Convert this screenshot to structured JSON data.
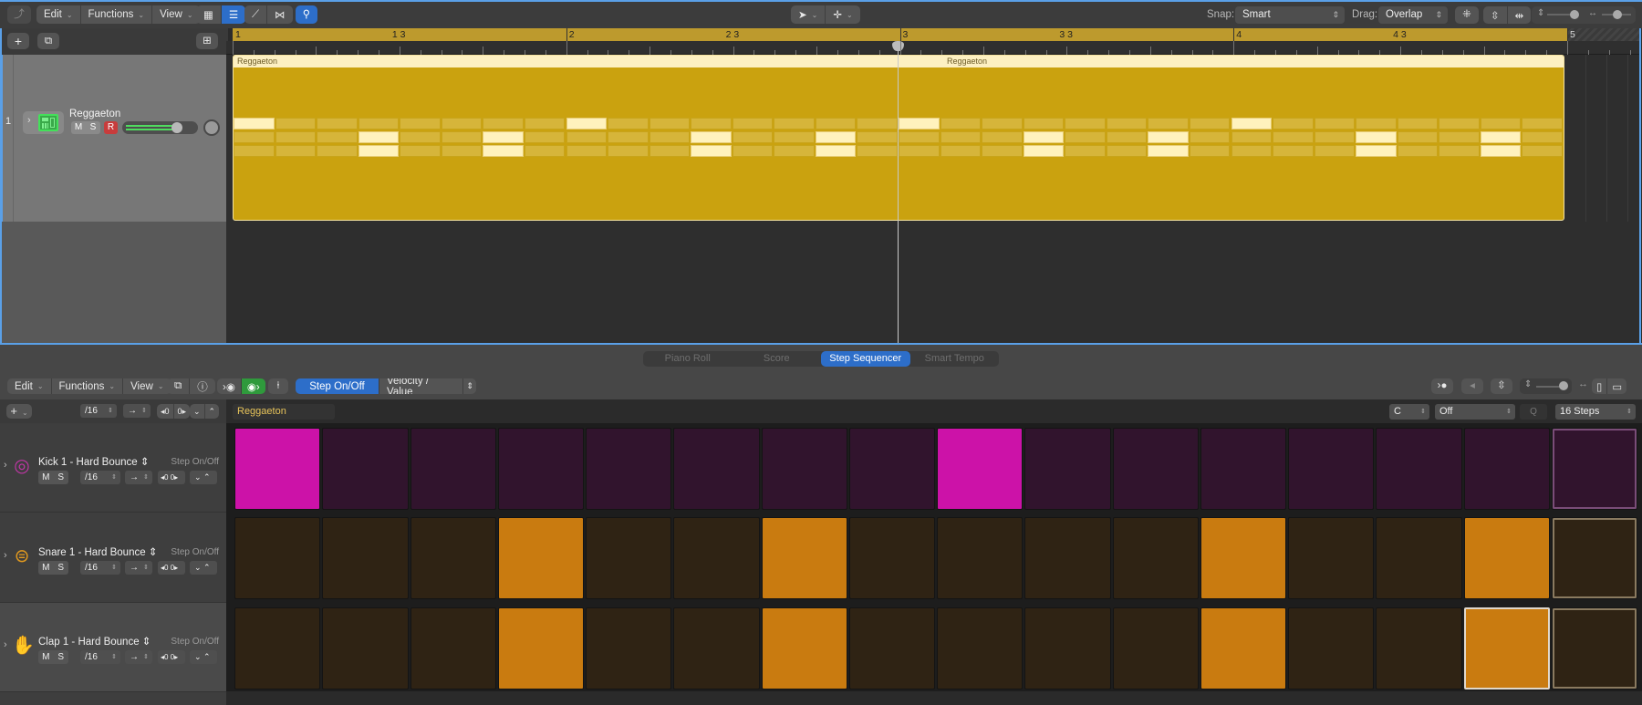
{
  "top_toolbar": {
    "back_icon": "back-arrow-icon",
    "menus": [
      "Edit",
      "Functions",
      "View"
    ],
    "view_buttons": [
      "grid-view-icon",
      "list-view-icon"
    ],
    "automation_buttons": [
      "automation-curve-icon",
      "flex-icon"
    ],
    "catch_button": "catch-playhead-icon",
    "pointer_tool": "pointer-tool-icon",
    "pencil_tool": "marquee-plus-tool-icon",
    "snap_label": "Snap:",
    "snap_value": "Smart",
    "drag_label": "Drag:",
    "drag_value": "Overlap",
    "waveform_zoom_icon": "waveform-zoom-icon",
    "vertical_auto_zoom_icon": "vertical-auto-zoom-icon",
    "horizontal_auto_zoom_icon": "horizontal-auto-zoom-icon",
    "vertical_zoom_level": 0.75,
    "horizontal_zoom_level": 0.75
  },
  "track_list_header": {
    "add_track_label": "+",
    "duplicate_track_icon": "duplicate-track-icon",
    "global_tracks_icon": "global-tracks-icon"
  },
  "ruler": {
    "bars": [
      "1",
      "1 3",
      "2",
      "2 3",
      "3",
      "3 3",
      "4",
      "4 3",
      "5"
    ]
  },
  "tracks": [
    {
      "number": "1",
      "name": "Reggaeton",
      "mute": "M",
      "solo": "S",
      "record": "R",
      "volume": 0.8,
      "pan": 0,
      "icon": "drum-machine-icon",
      "region": {
        "names": [
          "Reggaeton",
          "Reggaeton"
        ],
        "color": "#caa20f"
      }
    }
  ],
  "editor": {
    "tabs": [
      {
        "label": "Piano Roll",
        "active": false
      },
      {
        "label": "Score",
        "active": false
      },
      {
        "label": "Step Sequencer",
        "active": true
      },
      {
        "label": "Smart Tempo",
        "active": false
      }
    ],
    "menus": [
      "Edit",
      "Functions",
      "View"
    ],
    "mode_step_on_off": "Step On/Off",
    "mode_velocity": "Velocity / Value",
    "add_row_label": "+",
    "step_rate": "/16",
    "playback_direction": "→",
    "pattern_name": "Reggaeton",
    "key": "C",
    "scale": "Off",
    "quantize_label": "Q",
    "length": "16 Steps"
  },
  "step_rows": [
    {
      "name": "Kick 1 - Hard Bounce",
      "mode": "Step On/Off",
      "mute": "M",
      "solo": "S",
      "rate": "/16",
      "direction": "→",
      "icon": "kick-drum-icon",
      "on_color": "#cc12a8",
      "off_color": "#31142d",
      "steps": [
        1,
        0,
        0,
        0,
        0,
        0,
        0,
        0,
        1,
        0,
        0,
        0,
        0,
        0,
        0,
        0
      ]
    },
    {
      "name": "Snare 1 - Hard Bounce",
      "mode": "Step On/Off",
      "mute": "M",
      "solo": "S",
      "rate": "/16",
      "direction": "→",
      "icon": "snare-drum-icon",
      "on_color": "#c97b10",
      "off_color": "#2f2314",
      "steps": [
        0,
        0,
        0,
        1,
        0,
        0,
        1,
        0,
        0,
        0,
        0,
        1,
        0,
        0,
        1,
        0
      ]
    },
    {
      "name": "Clap 1 - Hard Bounce",
      "mode": "Step On/Off",
      "mute": "M",
      "solo": "S",
      "rate": "/16",
      "direction": "→",
      "icon": "clap-hand-icon",
      "on_color": "#c97b10",
      "off_color": "#2f2314",
      "steps": [
        0,
        0,
        0,
        1,
        0,
        0,
        1,
        0,
        0,
        0,
        0,
        1,
        0,
        0,
        1,
        0
      ],
      "selected_step": 15
    }
  ],
  "current_step": 16
}
